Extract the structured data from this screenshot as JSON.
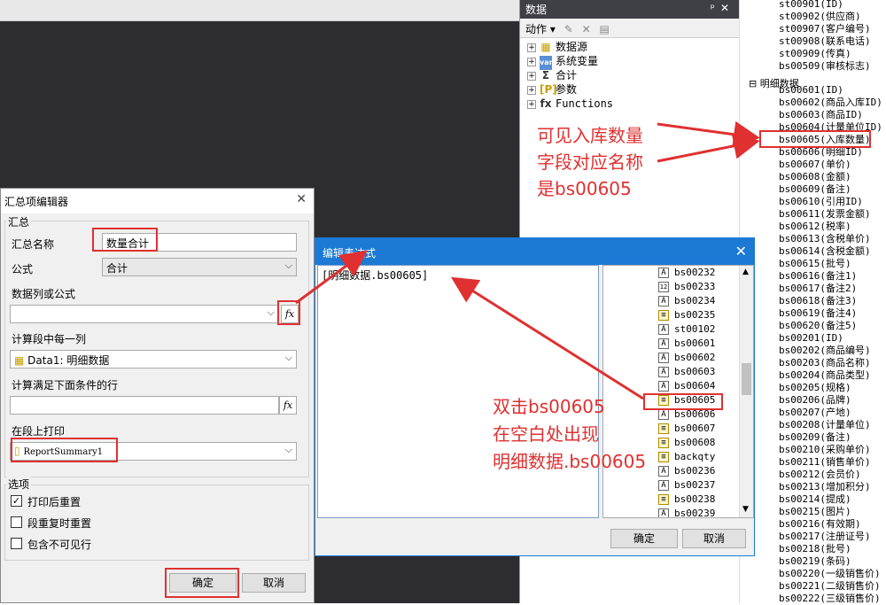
{
  "data_panel": {
    "title": "数据",
    "pin": "📌",
    "close": "✕",
    "action_label": "动作",
    "tree": [
      {
        "label": "数据源",
        "icon": "▦"
      },
      {
        "label": "系统变量",
        "icon": "var"
      },
      {
        "label": "合计",
        "icon": "Σ"
      },
      {
        "label": "参数",
        "icon": "[P]"
      },
      {
        "label": "Functions",
        "icon": "fx"
      }
    ]
  },
  "field_list": {
    "top_items": [
      "st00901(ID)",
      "st00902(供应商)",
      "st00907(客户编号)",
      "st00908(联系电话)",
      "st00909(传真)",
      "bs00509(审核标志)"
    ],
    "group_label": "明细数据",
    "detail_items": [
      "bs00601(ID)",
      "bs00602(商品入库ID)",
      "bs00603(商品ID)",
      "bs00604(计量单位ID)",
      "bs00605(入库数量)",
      "bs00606(明细ID)",
      "bs00607(单价)",
      "bs00608(金额)",
      "bs00609(备注)",
      "bs00610(引用ID)",
      "bs00611(发票金额)",
      "bs00612(税率)",
      "bs00613(含税单价)",
      "bs00614(含税金额)",
      "bs00615(批号)",
      "bs00616(备注1)",
      "bs00617(备注2)",
      "bs00618(备注3)",
      "bs00619(备注4)",
      "bs00620(备注5)",
      "bs00201(ID)",
      "bs00202(商品编号)",
      "bs00203(商品名称)",
      "bs00204(商品类型)",
      "bs00205(规格)",
      "bs00206(品牌)",
      "bs00207(产地)",
      "bs00208(计量单位)",
      "bs00209(备注)",
      "bs00210(采购单价)",
      "bs00211(销售单价)",
      "bs00212(会员价)",
      "bs00213(增加积分)",
      "bs00214(提成)",
      "bs00215(图片)",
      "bs00216(有效期)",
      "bs00217(注册证号)",
      "bs00218(批号)",
      "bs00219(条码)",
      "bs00220(一级销售价)",
      "bs00221(二级销售价)",
      "bs00222(三级销售价)"
    ]
  },
  "summary_dialog": {
    "title": "汇总项编辑器",
    "group_summary": "汇总",
    "name_label": "汇总名称",
    "name_value": "数量合计",
    "formula_label": "公式",
    "formula_value": "合计",
    "column_label": "数据列或公式",
    "column_value": "",
    "calc_each_label": "计算段中每一列",
    "calc_each_value": "Data1: 明细数据",
    "condition_label": "计算满足下面条件的行",
    "condition_value": "",
    "print_label": "在段上打印",
    "print_value": "ReportSummary1",
    "options_label": "选项",
    "opt1": "打印后重置",
    "opt2": "段重复时重置",
    "opt3": "包含不可见行",
    "ok": "确定",
    "cancel": "取消",
    "fx": "fx"
  },
  "expr_dialog": {
    "title": "编辑表达式",
    "expression": "[明细数据.bs00605]",
    "fields": [
      {
        "label": "bs00232",
        "type": "A"
      },
      {
        "label": "bs00233",
        "type": "12"
      },
      {
        "label": "bs00234",
        "type": "A"
      },
      {
        "label": "bs00235",
        "type": "E"
      },
      {
        "label": "st00102",
        "type": "A"
      },
      {
        "label": "bs00601",
        "type": "A"
      },
      {
        "label": "bs00602",
        "type": "A"
      },
      {
        "label": "bs00603",
        "type": "A"
      },
      {
        "label": "bs00604",
        "type": "A"
      },
      {
        "label": "bs00605",
        "type": "E"
      },
      {
        "label": "bs00606",
        "type": "A"
      },
      {
        "label": "bs00607",
        "type": "E"
      },
      {
        "label": "bs00608",
        "type": "E"
      },
      {
        "label": "backqty",
        "type": "E"
      },
      {
        "label": "bs00236",
        "type": "A"
      },
      {
        "label": "bs00237",
        "type": "A"
      },
      {
        "label": "bs00238",
        "type": "E"
      },
      {
        "label": "bs00239",
        "type": "A"
      }
    ],
    "ok": "确定",
    "cancel": "取消"
  },
  "annotations": {
    "top_right": [
      "可见入库数量",
      "字段对应名称",
      "是bs00605"
    ],
    "middle": [
      "双击bs00605",
      "在空白处出现",
      "明细数据.bs00605"
    ]
  },
  "colors": {
    "annotation_red": "#e03030",
    "title_blue": "#1c7ad4",
    "dark_bg": "#2d2d30"
  }
}
